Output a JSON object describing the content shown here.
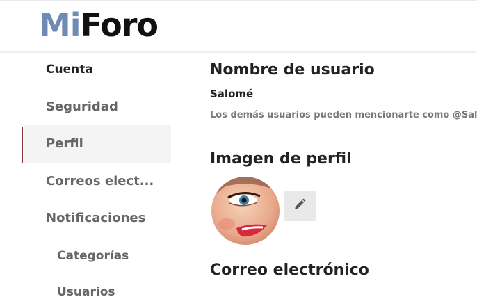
{
  "header": {
    "logo_mi": "Mi",
    "logo_foro": "Foro"
  },
  "nav": {
    "items": [
      {
        "label": "Cuenta"
      },
      {
        "label": "Seguridad"
      },
      {
        "label": "Perfil"
      },
      {
        "label": "Correos elect..."
      },
      {
        "label": "Notificaciones"
      },
      {
        "label": "Categorías"
      },
      {
        "label": "Usuarios"
      }
    ],
    "selected": "Perfil"
  },
  "main": {
    "username_title": "Nombre de usuario",
    "username_value": "Salomé",
    "username_hint": "Los demás usuarios pueden mencionarte como @Salomé",
    "avatar_title": "Imagen de perfil",
    "avatar_edit_icon": "pencil-icon",
    "email_title": "Correo electrónico"
  },
  "colors": {
    "logo_accent": "#6d8bb5",
    "focus_outline": "#8a2f3b",
    "selected_bg": "#f4f4f4",
    "button_bg": "#e9e9e9"
  }
}
